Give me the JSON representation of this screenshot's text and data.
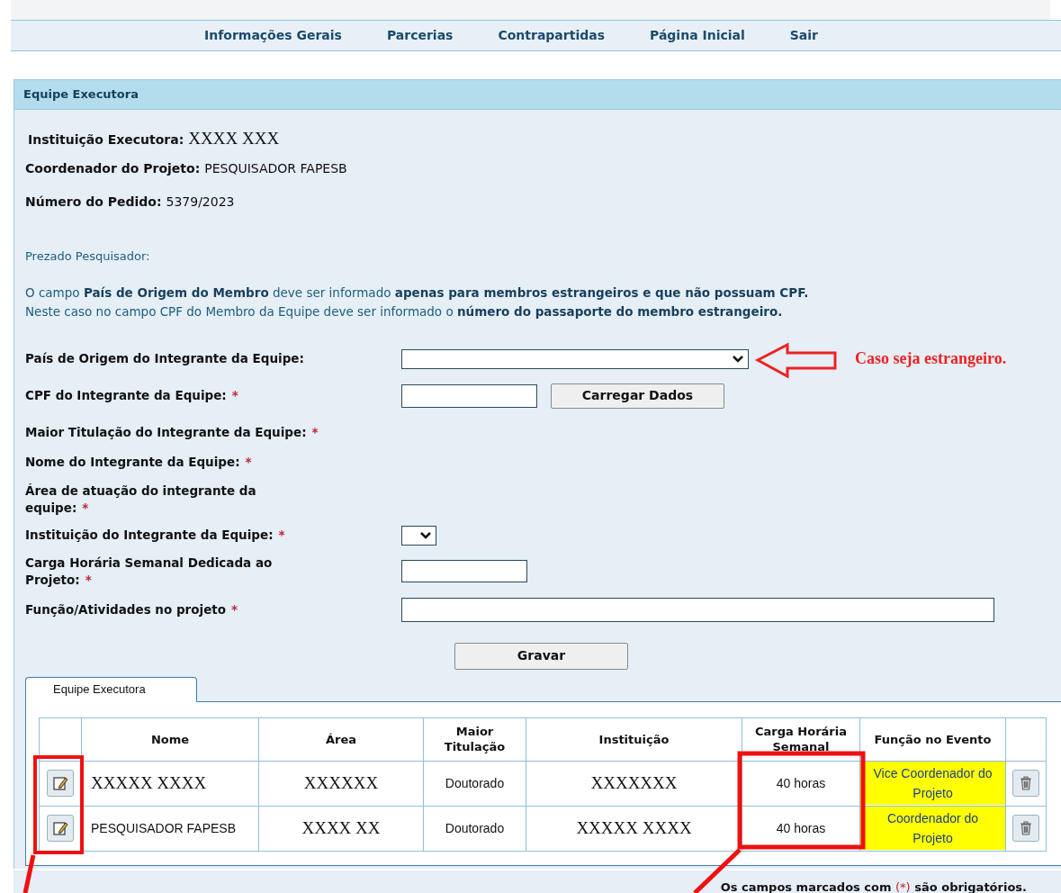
{
  "nav": {
    "items": [
      {
        "label": "Informações Gerais"
      },
      {
        "label": "Parcerias"
      },
      {
        "label": "Contrapartidas"
      },
      {
        "label": "Página Inicial"
      },
      {
        "label": "Sair"
      }
    ]
  },
  "panel": {
    "title": "Equipe Executora"
  },
  "info": [
    {
      "label": "Instituição Executora:",
      "value": "XXXX XXX",
      "kind": "typed-over"
    },
    {
      "label": "Coordenador do Projeto:",
      "value": "PESQUISADOR FAPESB",
      "kind": "text"
    },
    {
      "label": "Número do Pedido:",
      "value": "5379/2023",
      "kind": "text"
    }
  ],
  "notice": {
    "greeting": "Prezado Pesquisador:",
    "lines": [
      "O campo **País de Origem do Membro** deve ser informado **apenas para membros estrangeiros e que não possuam CPF.**",
      "Neste caso no campo CPF do Membro da Equipe deve ser informado o **número do passaporte do membro estrangeiro.**"
    ]
  },
  "form": [
    {
      "label": "País de Origem do Integrante da Equipe:",
      "kind": "select-wide",
      "callout": "Caso seja estrangeiro."
    },
    {
      "label": "CPF do Integrante da Equipe:",
      "required_mark": "*",
      "kind": "input-short",
      "button": "Carregar Dados"
    },
    {
      "label": "Maior Titulação do Integrante da Equipe:",
      "required_mark": "*",
      "kind": "text-only"
    },
    {
      "label": "Nome do Integrante da Equipe:",
      "required_mark": "*",
      "kind": "text-only"
    },
    {
      "label": "Área de atuação do integrante da equipe:",
      "required_mark": "*",
      "kind": "text-only"
    },
    {
      "label": "Instituição do Integrante da Equipe:",
      "required_mark": "*",
      "kind": "select-small"
    },
    {
      "label": "Carga Horária Semanal Dedicada ao Projeto:",
      "required_mark": "*",
      "kind": "input-medium"
    },
    {
      "label": "Função/Atividades no projeto",
      "required_mark": "*",
      "kind": "input-wide"
    }
  ],
  "save_button": "Gravar",
  "tabs": [
    {
      "label": "Equipe Executora",
      "selected": true
    }
  ],
  "table": {
    "columns": [
      "",
      "Nome",
      "Área",
      "Maior Titulação",
      "Instituição",
      "Carga Horária Semanal",
      "Função no Evento",
      ""
    ],
    "rows": [
      {
        "nome": {
          "text": "XXXXX XXXX",
          "kind": "typed-over"
        },
        "area": {
          "text": "XXXXXX",
          "kind": "typed-over"
        },
        "titulacao": "Doutorado",
        "instituicao": {
          "text": "XXXXXXX",
          "kind": "typed-over"
        },
        "carga": "40 horas",
        "funcao": "Vice Coordenador do Projeto",
        "highlighted": true
      },
      {
        "nome": {
          "text": "PESQUISADOR FAPESB",
          "kind": "text"
        },
        "area": {
          "text": "XXXX XX",
          "kind": "typed-over"
        },
        "titulacao": "Doutorado",
        "instituicao": {
          "text": "XXXXX XXXX",
          "kind": "typed-over"
        },
        "carga": "40 horas",
        "funcao": "Coordenador do Projeto",
        "highlighted": true
      }
    ]
  },
  "footer_note": {
    "before": "Os campos marcados com",
    "mark": "(*)",
    "after": "são obrigatórios."
  }
}
